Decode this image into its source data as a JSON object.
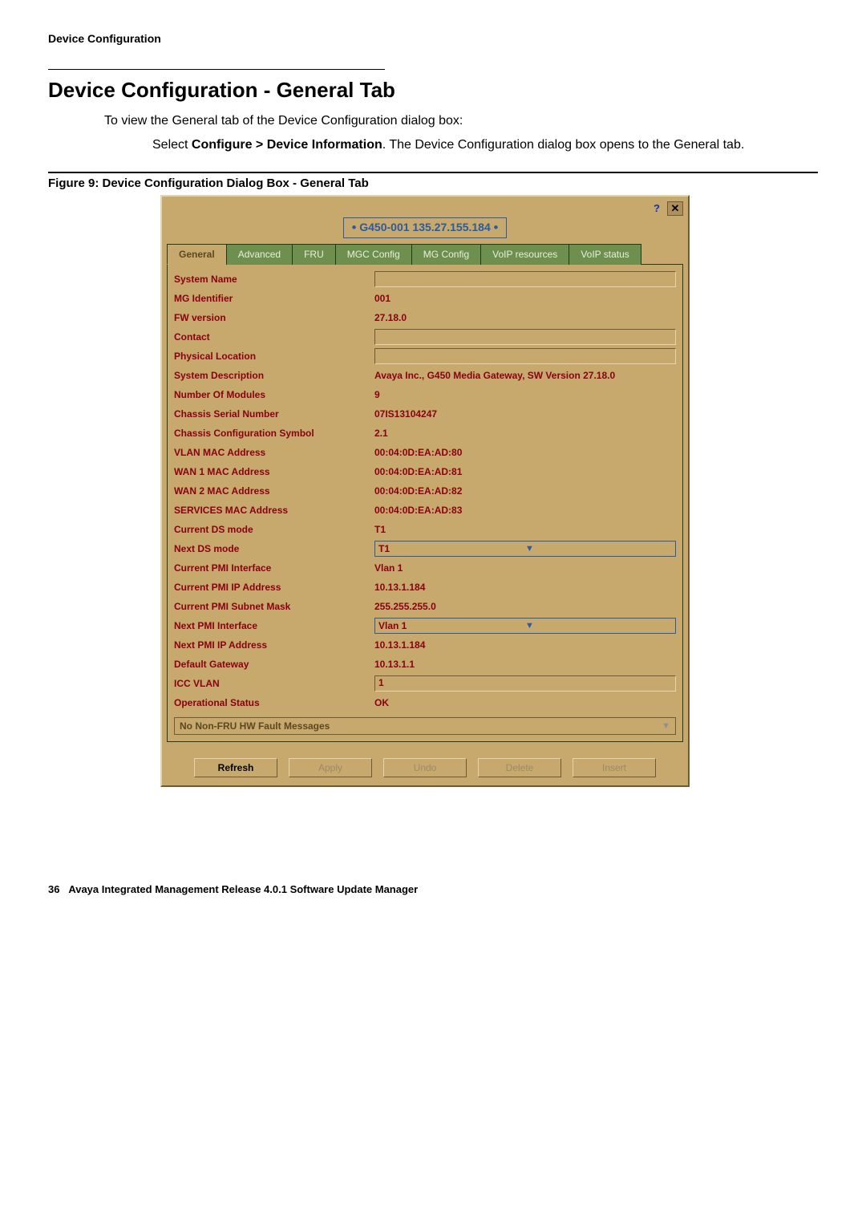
{
  "page": {
    "breadcrumb": "Device Configuration",
    "title": "Device Configuration - General Tab",
    "intro": "To view the General tab of the Device Configuration dialog box:",
    "step_prefix": "Select ",
    "step_bold": "Configure > Device Information",
    "step_suffix": ". The Device Configuration dialog box opens to the General tab.",
    "caption": "Figure 9: Device Configuration Dialog Box - General Tab",
    "footer_page": "36",
    "footer_text": "Avaya Integrated Management Release 4.0.1 Software Update Manager"
  },
  "dialog": {
    "title_core": "G450-001 135.27.155.184",
    "tabs": [
      "General",
      "Advanced",
      "FRU",
      "MGC Config",
      "MG Config",
      "VoIP resources",
      "VoIP status"
    ],
    "active_tab": 0,
    "rows": [
      {
        "label": "System Name",
        "type": "text",
        "value": ""
      },
      {
        "label": "MG Identifier",
        "type": "value",
        "value": "001"
      },
      {
        "label": "FW version",
        "type": "value",
        "value": "27.18.0"
      },
      {
        "label": "Contact",
        "type": "text",
        "value": ""
      },
      {
        "label": "Physical Location",
        "type": "text",
        "value": ""
      },
      {
        "label": "System Description",
        "type": "value",
        "value": "Avaya Inc., G450 Media Gateway, SW Version 27.18.0"
      },
      {
        "label": "Number Of Modules",
        "type": "value",
        "value": "9"
      },
      {
        "label": "Chassis Serial Number",
        "type": "value",
        "value": "07IS13104247"
      },
      {
        "label": "Chassis Configuration Symbol",
        "type": "value",
        "value": "2.1"
      },
      {
        "label": "VLAN MAC Address",
        "type": "value",
        "value": "00:04:0D:EA:AD:80"
      },
      {
        "label": "WAN 1 MAC Address",
        "type": "value",
        "value": "00:04:0D:EA:AD:81"
      },
      {
        "label": "WAN 2 MAC Address",
        "type": "value",
        "value": "00:04:0D:EA:AD:82"
      },
      {
        "label": "SERVICES MAC Address",
        "type": "value",
        "value": "00:04:0D:EA:AD:83"
      },
      {
        "label": "Current DS mode",
        "type": "value",
        "value": "T1"
      },
      {
        "label": "Next DS mode",
        "type": "combo",
        "value": "T1"
      },
      {
        "label": "Current PMI Interface",
        "type": "value",
        "value": "Vlan 1"
      },
      {
        "label": "Current PMI IP Address",
        "type": "value",
        "value": "10.13.1.184"
      },
      {
        "label": "Current PMI Subnet Mask",
        "type": "value",
        "value": "255.255.255.0"
      },
      {
        "label": "Next PMI Interface",
        "type": "combo",
        "value": "Vlan 1"
      },
      {
        "label": "Next PMI IP Address",
        "type": "value",
        "value": "10.13.1.184"
      },
      {
        "label": "Default Gateway",
        "type": "value",
        "value": "10.13.1.1"
      },
      {
        "label": "ICC VLAN",
        "type": "text",
        "value": "1"
      },
      {
        "label": "Operational Status",
        "type": "value",
        "value": "OK"
      }
    ],
    "message": "No Non-FRU HW Fault Messages",
    "buttons": [
      {
        "label": "Refresh",
        "enabled": true
      },
      {
        "label": "Apply",
        "enabled": false
      },
      {
        "label": "Undo",
        "enabled": false
      },
      {
        "label": "Delete",
        "enabled": false
      },
      {
        "label": "Insert",
        "enabled": false
      }
    ]
  }
}
